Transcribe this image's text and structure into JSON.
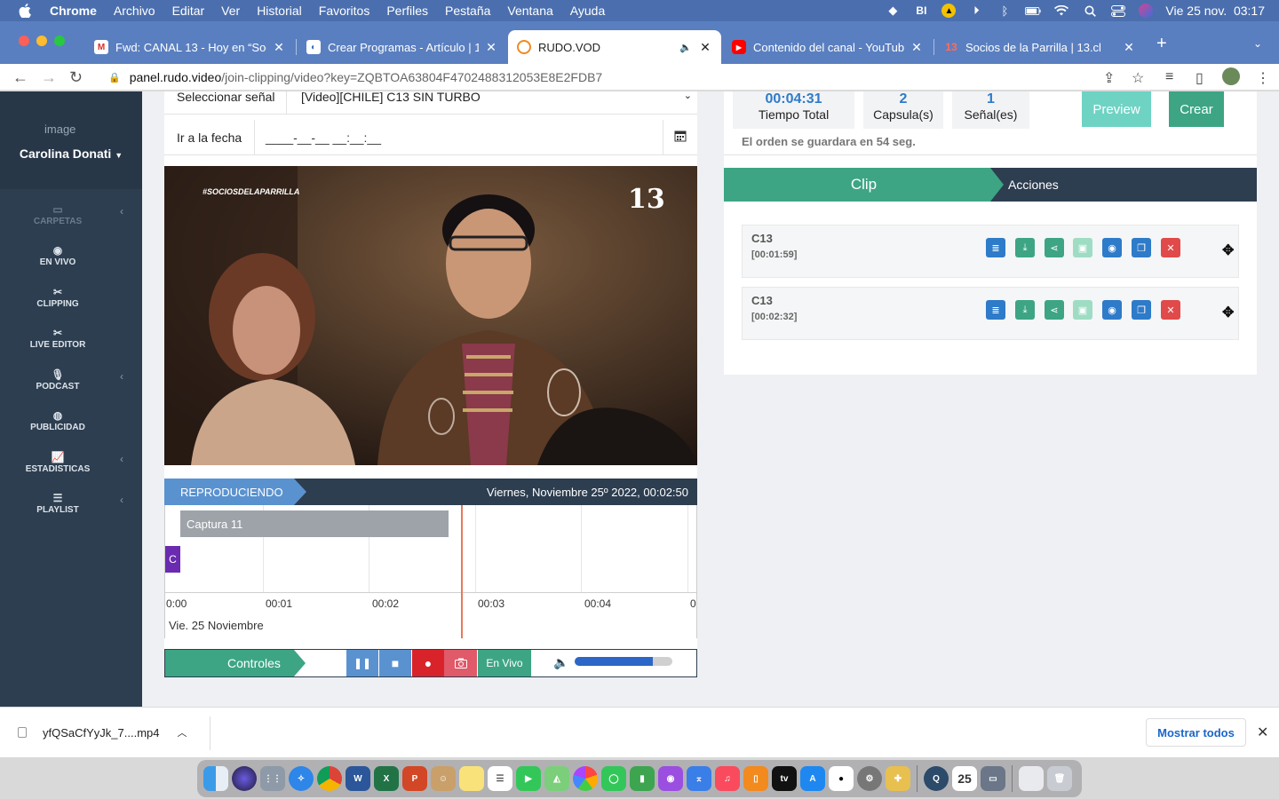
{
  "menubar": {
    "app": "Chrome",
    "items": [
      "Archivo",
      "Editar",
      "Ver",
      "Historial",
      "Favoritos",
      "Perfiles",
      "Pestaña",
      "Ventana",
      "Ayuda"
    ],
    "clock": "Vie 25 nov.  03:17"
  },
  "tabs": [
    {
      "label": "Fwd: CANAL 13 - Hoy en “Soci",
      "icon": "gmail-icon",
      "color": "#d93025"
    },
    {
      "label": "Crear Programas - Artículo | 13",
      "icon": "edge-icon",
      "color": "#2d6fc9"
    },
    {
      "label": "RUDO.VOD",
      "icon": "rudo-icon",
      "color": "#f08a24"
    },
    {
      "label": "Contenido del canal - YouTube",
      "icon": "youtube-icon",
      "color": "#ff0000"
    },
    {
      "label": "Socios de la Parrilla | 13.cl",
      "icon": "canal13-icon",
      "color": "#e74c3c"
    }
  ],
  "address": {
    "domain": "panel.rudo.video",
    "path": "/join-clipping/video?key=ZQBTOA63804F4702488312053E8E2FDB7"
  },
  "sidebar": {
    "image_alt": "image",
    "user": "Carolina Donati",
    "items": [
      {
        "label": "CARPETAS",
        "icon": "folder-icon",
        "chevron": true
      },
      {
        "label": "EN VIVO",
        "icon": "live-icon",
        "chevron": false
      },
      {
        "label": "CLIPPING",
        "icon": "scissors-icon",
        "chevron": false
      },
      {
        "label": "LIVE EDITOR",
        "icon": "scissors-icon",
        "chevron": false
      },
      {
        "label": "PODCAST",
        "icon": "microphone-icon",
        "chevron": true
      },
      {
        "label": "PUBLICIDAD",
        "icon": "globe-icon",
        "chevron": false
      },
      {
        "label": "ESTADISTICAS",
        "icon": "chart-icon",
        "chevron": true
      },
      {
        "label": "PLAYLIST",
        "icon": "list-icon",
        "chevron": true
      }
    ]
  },
  "form": {
    "signal_label": "Seleccionar señal",
    "signal_value": "[Video][CHILE] C13 SIN TURBO",
    "date_label": "Ir a la fecha",
    "date_placeholder": "____-__-__ __:__:__"
  },
  "video": {
    "hashtag": "#SOCIOSDELAPARRILLA",
    "channel_logo": "13"
  },
  "status": {
    "playing": "REPRODUCIENDO",
    "datetime": "Viernes, Noviembre 25º 2022, 00:02:50"
  },
  "timeline": {
    "capture_label": "Captura 11",
    "marker_label": "C",
    "ticks": [
      "0:00",
      "00:01",
      "00:02",
      "00:03",
      "00:04",
      "0"
    ],
    "date": "Vie. 25 Noviembre"
  },
  "controls": {
    "label": "Controles",
    "live": "En Vivo",
    "volume": 0.8
  },
  "summary": {
    "total_time": "00:04:31",
    "total_time_label": "Tiempo Total",
    "capsules": "2",
    "capsules_label": "Capsula(s)",
    "signals": "1",
    "signals_label": "Señal(es)",
    "preview": "Preview",
    "create": "Crear",
    "order_note": "El orden se guardara en 54 seg."
  },
  "cliplist": {
    "tab_clip": "Clip",
    "tab_actions": "Acciones",
    "rows": [
      {
        "name": "C13",
        "time": "[00:01:59]"
      },
      {
        "name": "C13",
        "time": "[00:02:32]"
      }
    ]
  },
  "download": {
    "filename": "yfQSaCfYyJk_7....mp4",
    "show_all": "Mostrar todos"
  }
}
